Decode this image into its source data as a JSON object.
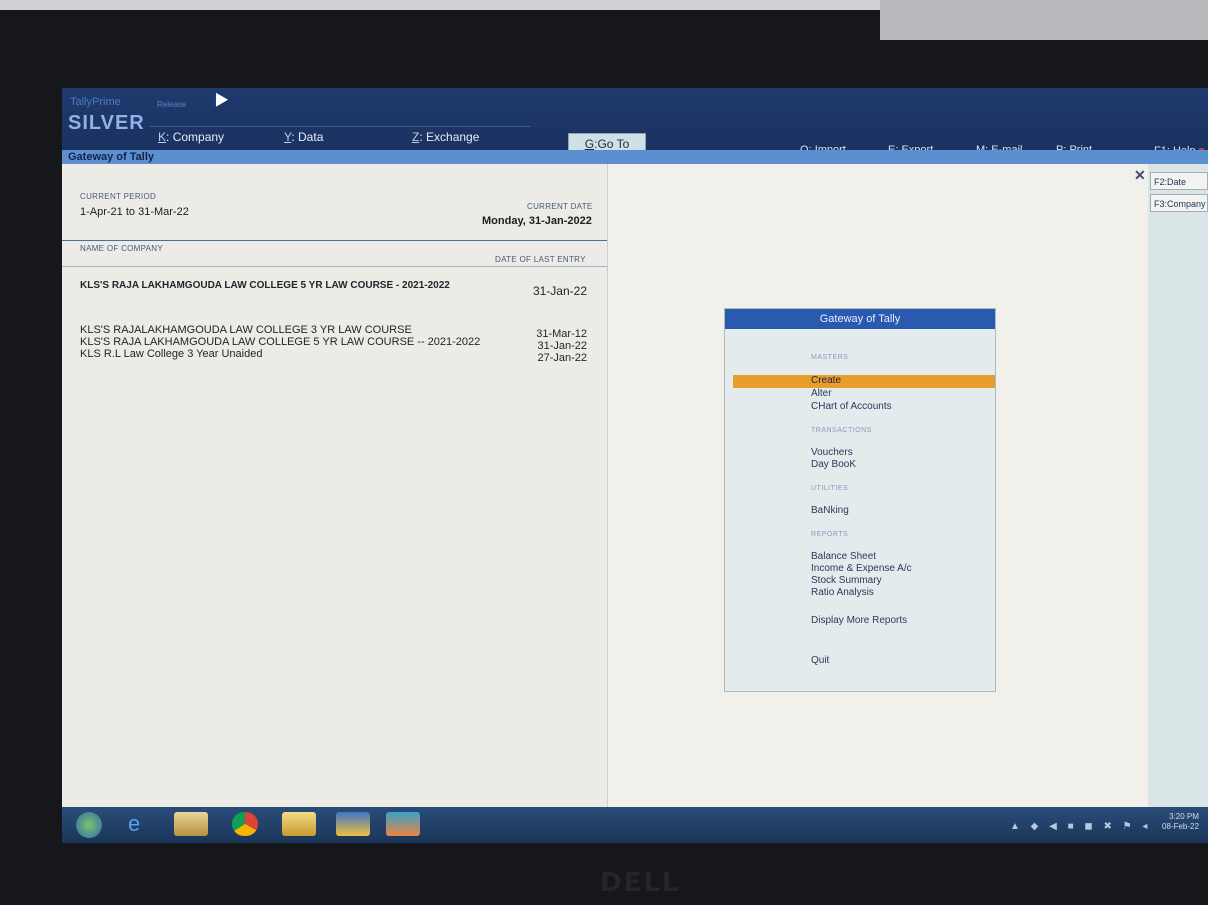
{
  "app": {
    "brand_small": "TallyPrime",
    "brand_version": "Release",
    "brand_edition": "SILVER"
  },
  "top_menu": [
    {
      "key": "K",
      "label": "Company"
    },
    {
      "key": "Y",
      "label": "Data"
    },
    {
      "key": "Z",
      "label": "Exchange"
    }
  ],
  "goto": {
    "key": "G",
    "label": "Go To"
  },
  "right_menu": [
    {
      "key": "O",
      "label": "Import"
    },
    {
      "key": "E",
      "label": "Export"
    },
    {
      "key": "M",
      "label": "E-mail"
    },
    {
      "key": "P",
      "label": "Print"
    },
    {
      "key": "F1",
      "label": "Help"
    }
  ],
  "gateway_title": "Gateway of Tally",
  "info": {
    "current_period_label": "CURRENT PERIOD",
    "current_period": "1-Apr-21 to 31-Mar-22",
    "current_date_label": "CURRENT DATE",
    "current_date": "Monday, 31-Jan-2022",
    "name_of_company_label": "NAME OF COMPANY",
    "date_last_entry_label": "DATE OF LAST ENTRY"
  },
  "active_company": {
    "name": "KLS'S RAJA LAKHAMGOUDA LAW COLLEGE  5 YR LAW COURSE - 2021-2022",
    "date": "31-Jan-22"
  },
  "companies": [
    {
      "name": "KLS'S RAJALAKHAMGOUDA LAW COLLEGE 3 YR LAW COURSE",
      "date": "31-Mar-12"
    },
    {
      "name": "KLS'S RAJA LAKHAMGOUDA LAW COLLEGE  5 YR LAW COURSE -- 2021-2022",
      "date": "31-Jan-22"
    },
    {
      "name": "KLS R.L Law College 3 Year Unaided",
      "date": "27-Jan-22"
    }
  ],
  "button_bar": [
    {
      "key": "F2",
      "label": "Date"
    },
    {
      "key": "F3",
      "label": "Company"
    }
  ],
  "gateway_menu": {
    "title": "Gateway of Tally",
    "sections": {
      "masters": "MASTERS",
      "transactions": "TRANSACTIONS",
      "utilities": "UTILITIES",
      "reports": "REPORTS"
    },
    "items": {
      "create": "Create",
      "alter": "Alter",
      "chart": "CHart of Accounts",
      "vouchers": "Vouchers",
      "daybook": "Day BooK",
      "banking": "BaNking",
      "balance": "Balance Sheet",
      "income": "Income & Expense A/c",
      "stock": "Stock Summary",
      "ratio": "Ratio Analysis",
      "more": "Display More Reports",
      "quit": "Quit"
    }
  },
  "taskbar": {
    "icons": [
      "start-orb",
      "ie",
      "explorer",
      "chrome",
      "folder",
      "tally",
      "app"
    ],
    "time": "3:20 PM",
    "date": "08-Feb-22"
  },
  "monitor_brand": "DELL",
  "colors": {
    "topbar": "#1e3a6c",
    "gateway_bar": "#5b8fd0",
    "selection": "#e79e2c",
    "menu_header": "#2a59b0"
  }
}
